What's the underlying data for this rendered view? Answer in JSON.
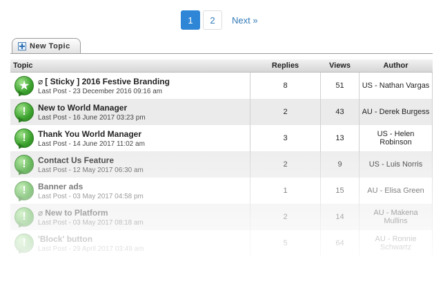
{
  "pagination": {
    "pages": [
      "1",
      "2"
    ],
    "active": "1",
    "next": "Next »"
  },
  "new_topic": "New Topic",
  "columns": {
    "topic": "Topic",
    "replies": "Replies",
    "views": "Views",
    "author": "Author"
  },
  "topics": [
    {
      "title": "[ Sticky ] 2016 Festive Branding",
      "attachment": true,
      "icon": "sticky-star-icon",
      "last_post": "Last Post - 23 December 2016 09:16 am",
      "replies": "8",
      "views": "51",
      "author": "US - Nathan Vargas"
    },
    {
      "title": "New to World Manager",
      "attachment": false,
      "icon": "exclamation-icon",
      "last_post": "Last Post - 16 June 2017 03:23 pm",
      "replies": "2",
      "views": "43",
      "author": "AU - Derek Burgess"
    },
    {
      "title": "Thank You World Manager",
      "attachment": false,
      "icon": "exclamation-icon",
      "last_post": "Last Post - 14 June 2017 11:02 am",
      "replies": "3",
      "views": "13",
      "author": "US - Helen Robinson"
    },
    {
      "title": "Contact Us Feature",
      "attachment": false,
      "icon": "exclamation-icon",
      "last_post": "Last Post - 12 May 2017 06:30 am",
      "replies": "2",
      "views": "9",
      "author": "US - Luis Norris"
    },
    {
      "title": "Banner ads",
      "attachment": false,
      "icon": "exclamation-icon",
      "last_post": "Last Post - 03 May 2017 04:58 pm",
      "replies": "1",
      "views": "15",
      "author": "AU - Elisa Green"
    },
    {
      "title": "New to Platform",
      "attachment": true,
      "icon": "exclamation-icon",
      "last_post": "Last Post - 03 May 2017 08:18 am",
      "replies": "2",
      "views": "14",
      "author": "AU - Makena Mullins"
    },
    {
      "title": "'Block' button",
      "attachment": false,
      "icon": "exclamation-icon",
      "last_post": "Last Post - 29 April 2017 03:49 am",
      "replies": "5",
      "views": "64",
      "author": "AU - Ronnie Schwartz"
    }
  ]
}
